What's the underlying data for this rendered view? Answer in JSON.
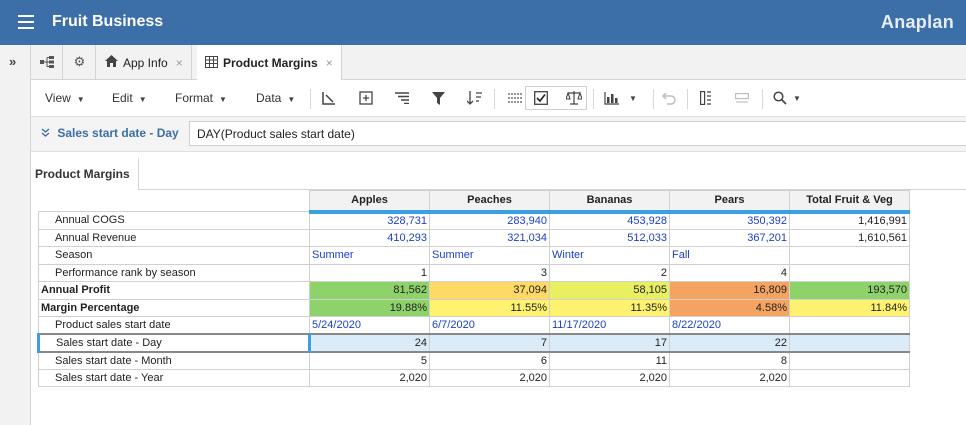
{
  "app": {
    "title": "Fruit Business",
    "brand": "Anaplan"
  },
  "tabs": [
    {
      "label": "App Info"
    },
    {
      "label": "Product Margins"
    }
  ],
  "toolbar": {
    "menus": [
      "View",
      "Edit",
      "Format",
      "Data"
    ]
  },
  "filter": {
    "label": "Sales start date - Day",
    "formula": "DAY(Product sales start date)"
  },
  "panel": {
    "title": "Product Margins"
  },
  "grid": {
    "columns": [
      "Apples",
      "Peaches",
      "Bananas",
      "Pears",
      "Total Fruit & Veg"
    ],
    "rows": [
      {
        "label": "Annual COGS",
        "values": [
          "328,731",
          "283,940",
          "453,928",
          "350,392",
          "1,416,991"
        ]
      },
      {
        "label": "Annual Revenue",
        "values": [
          "410,293",
          "321,034",
          "512,033",
          "367,201",
          "1,610,561"
        ]
      },
      {
        "label": "Season",
        "values": [
          "Summer",
          "Summer",
          "Winter",
          "Fall",
          ""
        ]
      },
      {
        "label": "Performance rank by season",
        "values": [
          "1",
          "3",
          "2",
          "4",
          ""
        ]
      },
      {
        "label": "Annual Profit",
        "values": [
          "81,562",
          "37,094",
          "58,105",
          "16,809",
          "193,570"
        ]
      },
      {
        "label": "Margin Percentage",
        "values": [
          "19.88%",
          "11.55%",
          "11.35%",
          "4.58%",
          "11.84%"
        ]
      },
      {
        "label": "Product sales start date",
        "values": [
          "5/24/2020",
          "6/7/2020",
          "11/17/2020",
          "8/22/2020",
          ""
        ]
      },
      {
        "label": "Sales start date - Day",
        "values": [
          "24",
          "7",
          "17",
          "22",
          ""
        ]
      },
      {
        "label": "Sales start date - Month",
        "values": [
          "5",
          "6",
          "11",
          "8",
          ""
        ]
      },
      {
        "label": "Sales start date - Year",
        "values": [
          "2,020",
          "2,020",
          "2,020",
          "2,020",
          ""
        ]
      }
    ],
    "colors": {
      "profit": [
        "#8ed36a",
        "#ffd966",
        "#e8f060",
        "#f4a460",
        "#8ed36a"
      ],
      "margin": [
        "#8ed36a",
        "#fff270",
        "#fff270",
        "#f4a460",
        "#fff270"
      ]
    }
  }
}
